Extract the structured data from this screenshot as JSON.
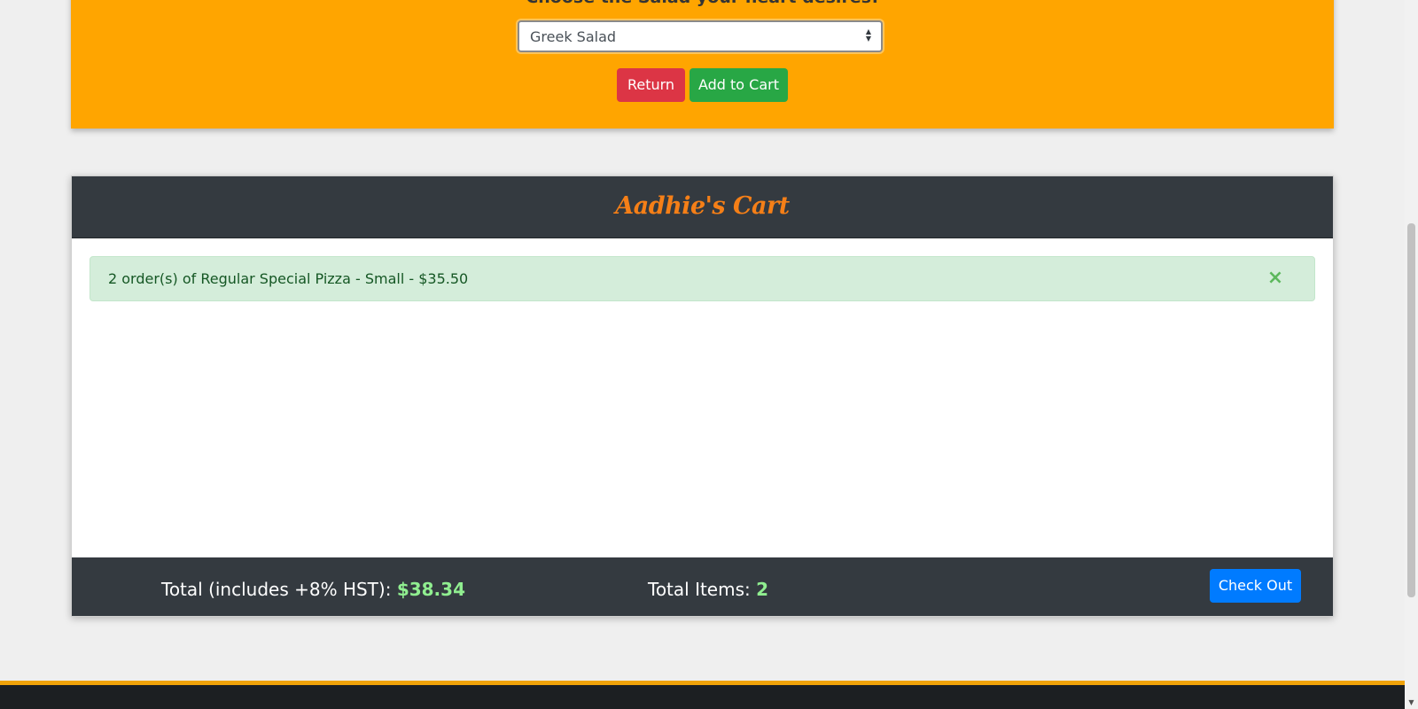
{
  "selection": {
    "heading": "Choose the Salad your heart desires!",
    "select_value": "Greek Salad",
    "return_label": "Return",
    "add_label": "Add to Cart"
  },
  "cart": {
    "title": "Aadhie's Cart",
    "items": [
      {
        "text": "2 order(s) of Regular Special Pizza - Small - $35.50",
        "remove_icon": "×"
      }
    ],
    "footer": {
      "total_label": "Total (includes +8% HST): ",
      "total_value": "$38.34",
      "items_label": "Total Items: ",
      "items_value": "2",
      "checkout_label": "Check Out"
    }
  },
  "colors": {
    "panel_orange": "#ffa500",
    "dark_header": "#343a40",
    "title_orange": "#f57f17",
    "success_bg": "#d4edda",
    "success_text": "#155724",
    "highlight_green": "#90ee90",
    "return_red": "#dc3545",
    "add_green": "#28a745",
    "checkout_blue": "#007bff"
  },
  "icons": {
    "remove": "close-icon",
    "select_arrows": "select-arrows-icon",
    "scroll_down": "scroll-down-arrow-icon"
  }
}
